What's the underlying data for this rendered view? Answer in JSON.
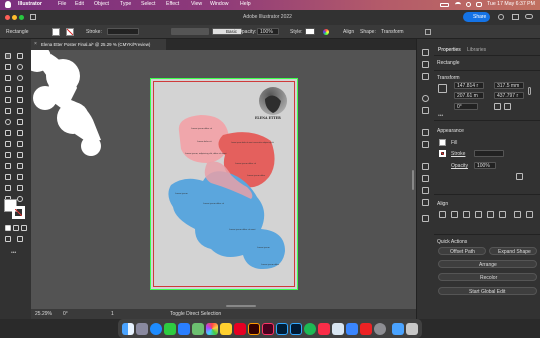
{
  "menubar": {
    "items": [
      "Illustrator",
      "File",
      "Edit",
      "Object",
      "Type",
      "Select",
      "Effect",
      "View",
      "Window",
      "Help"
    ],
    "datetime": "Tue 17 May  6:37 PM"
  },
  "titlebar": {
    "title": "Adobe Illustrator 2022",
    "share_label": "Share"
  },
  "controlbar": {
    "object": "Rectangle",
    "stroke_label": "Stroke:",
    "brush": "Basic",
    "opacity_label": "Opacity:",
    "opacity_value": "100%",
    "style_label": "Style:",
    "align_label": "Align",
    "shape_label": "Shape:",
    "transform_label": "Transform"
  },
  "document": {
    "tab_title": "Elena Etter Poster Final.ai* @ 25.29 % (CMYK/Preview)"
  },
  "poster": {
    "name_label": "ELENA ETTER",
    "blobs": [
      {
        "name": "pink",
        "texts": [
          "Lorem ipsum dolor sit",
          "Lorem dolor sit",
          "Lorem ipsum, adipiscing elit, dolor sit amet"
        ]
      },
      {
        "name": "red",
        "texts": [
          "Lorem ipsum dolor sit amet consectetur adipiscing elit",
          "Lorem ipsum dolor sit",
          "Lorem ipsum dolor"
        ]
      },
      {
        "name": "blue",
        "texts": [
          "Lorem ipsum",
          "Lorem ipsum dolor sit",
          "Lorem ipsum dolor sit amet",
          "Lorem ipsum",
          "Lorem ipsum dolor"
        ]
      }
    ]
  },
  "statusbar": {
    "zoom": "25.29%",
    "rotation": "0°",
    "page": "1",
    "tool": "Toggle Direct Selection"
  },
  "properties": {
    "tabs": [
      "Properties",
      "Libraries"
    ],
    "selection": "Rectangle",
    "transform": {
      "label": "Transform",
      "x": "147.814 r",
      "y": "207.61 m",
      "w": "317.5 mm",
      "h": "437.797 r",
      "angle": "0°"
    },
    "appearance": {
      "label": "Appearance",
      "fill_label": "Fill",
      "stroke_label": "Stroke",
      "opacity_label": "Opacity",
      "opacity_value": "100%"
    },
    "align": {
      "label": "Align"
    },
    "quick_actions": {
      "label": "Quick Actions",
      "offset": "Offset Path",
      "expand": "Expand Shape",
      "arrange": "Arrange",
      "recolor": "Recolor",
      "global_edit": "Start Global Edit"
    }
  },
  "colors": {
    "pink": "#f0a0a6",
    "red": "#e15c5a",
    "blue": "#5ba6dd",
    "artboard_frame": "#cf3a3a",
    "selection": "#3cff4c"
  }
}
